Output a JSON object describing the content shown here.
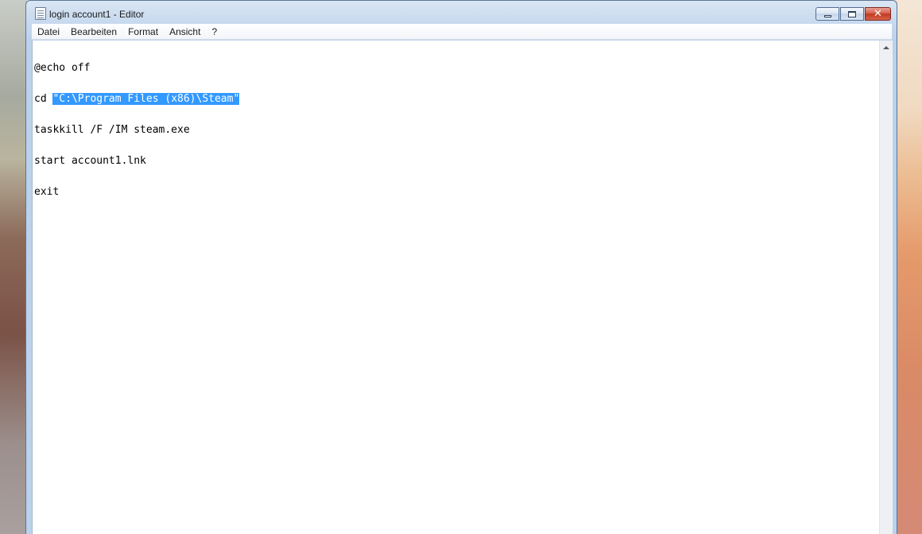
{
  "window": {
    "title": "login account1 - Editor"
  },
  "menu": {
    "items": [
      "Datei",
      "Bearbeiten",
      "Format",
      "Ansicht",
      "?"
    ]
  },
  "editor": {
    "line1": "@echo off",
    "line2_prefix": "cd ",
    "line2_selected": "\"C:\\Program Files (x86)\\Steam\"",
    "line3": "taskkill /F /IM steam.exe",
    "line4": "start account1.lnk",
    "line5": "exit",
    "selection_color": "#3399ff"
  },
  "icons": {
    "app": "notepad-icon",
    "minimize": "minimize-icon",
    "maximize": "maximize-icon",
    "close": "close-icon",
    "scroll_up": "scroll-up-arrow-icon"
  }
}
